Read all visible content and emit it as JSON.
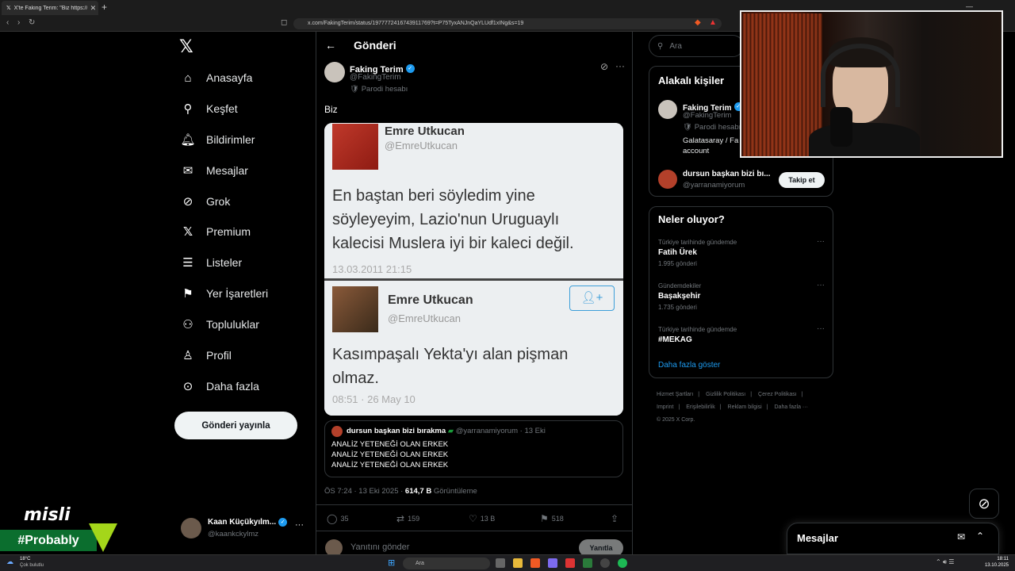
{
  "browser": {
    "tab_title": "X'te Faking Terim: \"Biz https://t.c",
    "url": "x.com/FakingTerim/status/1977772416743911769?t=P75TyxANJnQaYLUdf1xINg&s=19"
  },
  "nav": {
    "items": [
      "Anasayfa",
      "Keşfet",
      "Bildirimler",
      "Mesajlar",
      "Grok",
      "Premium",
      "Listeler",
      "Yer İşaretleri",
      "Topluluklar",
      "Profil",
      "Daha fazla"
    ],
    "post_button": "Gönderi yayınla",
    "account_name": "Kaan Küçükyılm...",
    "account_handle": "@kaankckylmz"
  },
  "header": {
    "title": "Gönderi"
  },
  "tweet": {
    "name": "Faking Terim",
    "handle": "@FakingTerim",
    "parody_label": "Parodi hesabı",
    "text": "Biz",
    "image": {
      "top_name": "Emre Utkucan",
      "top_handle": "@EmreUtkucan",
      "top_text_1": "En baştan beri söyledim yine",
      "top_text_2": "söyleyeyim, Lazio'nun Uruguaylı",
      "top_text_3": "kalecisi Muslera iyi bir kaleci değil.",
      "top_date": "13.03.2011 21:15",
      "bot_name": "Emre Utkucan",
      "bot_handle": "@EmreUtkucan",
      "bot_text_1": "Kasımpaşalı Yekta'yı alan pişman",
      "bot_text_2": "olmaz.",
      "bot_date": "08:51 · 26 May 10"
    },
    "quote": {
      "name": "dursun başkan bizi bırakma",
      "handle": "@yarranamiyorum",
      "date": "· 13 Eki",
      "line": "ANALİZ YETENEĞİ OLAN ERKEK"
    },
    "time": "ÖS 7:24 · 13 Eki 2025 ·",
    "views": "614,7 B",
    "views_label": "Görüntüleme",
    "replies": "35",
    "retweets": "159",
    "likes": "13 B",
    "bookmarks": "518",
    "reply_placeholder": "Yanıtını gönder",
    "reply_button": "Yanıtla"
  },
  "right": {
    "search_placeholder": "Ara",
    "related_title": "Alakalı kişiler",
    "related": [
      {
        "name": "Faking Terim",
        "handle": "@FakingTerim",
        "badge": "Parodi hesabı",
        "bio_1": "Galatasaray / Fa",
        "bio_2": "account"
      },
      {
        "name": "dursun başkan bizi bı...",
        "handle": "@yarranamiyorum",
        "button": "Takip et"
      }
    ],
    "trends_title": "Neler oluyor?",
    "trends": [
      {
        "category": "Türkiye tarihinde gündemde",
        "name": "Fatih Ürek",
        "count": "1.995 gönderi"
      },
      {
        "category": "Gündemdekiler",
        "name": "Başakşehir",
        "count": "1.735 gönderi"
      },
      {
        "category": "Türkiye tarihinde gündemde",
        "name": "#MEKAG",
        "count": ""
      }
    ],
    "show_more": "Daha fazla göster",
    "footer": [
      "Hizmet Şartları",
      "|",
      "Gizlilik Politikası",
      "|",
      "Çerez Politikası",
      "|",
      "Imprint",
      "|",
      "Erişilebilirlik",
      "|",
      "Reklam bilgisi",
      "|",
      "Daha fazla ···",
      "© 2025 X Corp."
    ]
  },
  "messages_drawer": {
    "title": "Mesajlar"
  },
  "overlay": {
    "brand": "misli",
    "tag": "#Probably"
  },
  "taskbar": {
    "weather_temp": "18°C",
    "weather_desc": "Çok bulutlu",
    "search": "Ara",
    "time": "18:11",
    "date": "13.10.2025"
  },
  "colors": {
    "accent": "#1d9bf0",
    "background": "#000000",
    "brand_green": "#0b6e2e",
    "brand_lime": "#a4d61a"
  }
}
